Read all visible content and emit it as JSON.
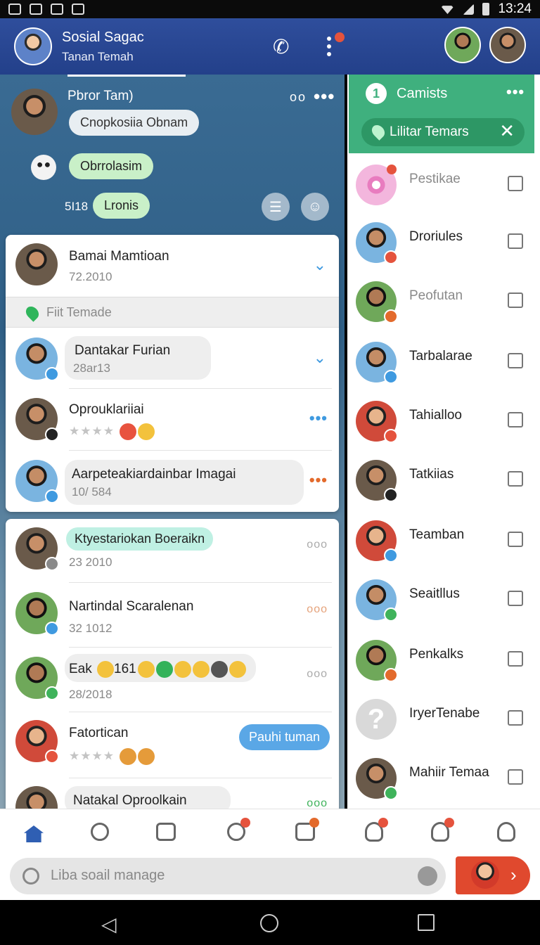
{
  "status_bar": {
    "time": "13:24"
  },
  "header": {
    "title": "Sosial Sagac",
    "subtitle": "Tanan Temah"
  },
  "chat": {
    "sender_name": "Pbror Tam)",
    "messages": [
      {
        "text": "Cnopkosiia Obnam"
      },
      {
        "text": "Obrrolasim"
      },
      {
        "text": "Lronis",
        "time": "5I18"
      }
    ]
  },
  "card1": {
    "rows": [
      {
        "name": "Bamai Mamtioan",
        "meta": "72.2010"
      }
    ],
    "filter_label": "Fiit Temade",
    "rows2": [
      {
        "name": "Dantakar Furian",
        "meta": "28ar13"
      },
      {
        "name": "Oprouklariiai",
        "meta": "★★★★"
      },
      {
        "name": "Aarpeteakiardainbar Imagai",
        "meta": "10/ 584"
      }
    ]
  },
  "card2": {
    "rows": [
      {
        "name": "Ktyestariokan Boeraikn",
        "meta": "23 2010"
      },
      {
        "name": "Nartindal Scaralenan",
        "meta": "32 1012"
      },
      {
        "name": "Eak",
        "extra": "161",
        "meta": "28/2018"
      },
      {
        "name": "Fatortican",
        "meta": "★★★★",
        "reply": "Pauhi tuman"
      },
      {
        "name": "Natakal Oproolkain"
      }
    ]
  },
  "right_panel": {
    "title": "Camists",
    "search_label": "Lilitar Temars",
    "items": [
      {
        "name": "Pestikae",
        "dim": true
      },
      {
        "name": "Droriules"
      },
      {
        "name": "Peofutan",
        "dim": true
      },
      {
        "name": "Tarbalarae"
      },
      {
        "name": "Tahialloo"
      },
      {
        "name": "Tatkiias"
      },
      {
        "name": "Teamban"
      },
      {
        "name": "Seaitllus"
      },
      {
        "name": "Penkalks"
      },
      {
        "name": "IryerTenabe"
      },
      {
        "name": "Mahiir Temaa"
      }
    ]
  },
  "bottom_nav": {
    "items": [
      "home",
      "search",
      "camera",
      "notifications",
      "news",
      "alerts",
      "friends",
      "profile"
    ]
  },
  "search": {
    "placeholder": "Liba soail manage"
  },
  "colors": {
    "header": "#2f4e9c",
    "panel_accent": "#3fb07e",
    "link_blue": "#3f9ae0",
    "reply_blue": "#5aa7e6",
    "send_red": "#e0492e"
  }
}
